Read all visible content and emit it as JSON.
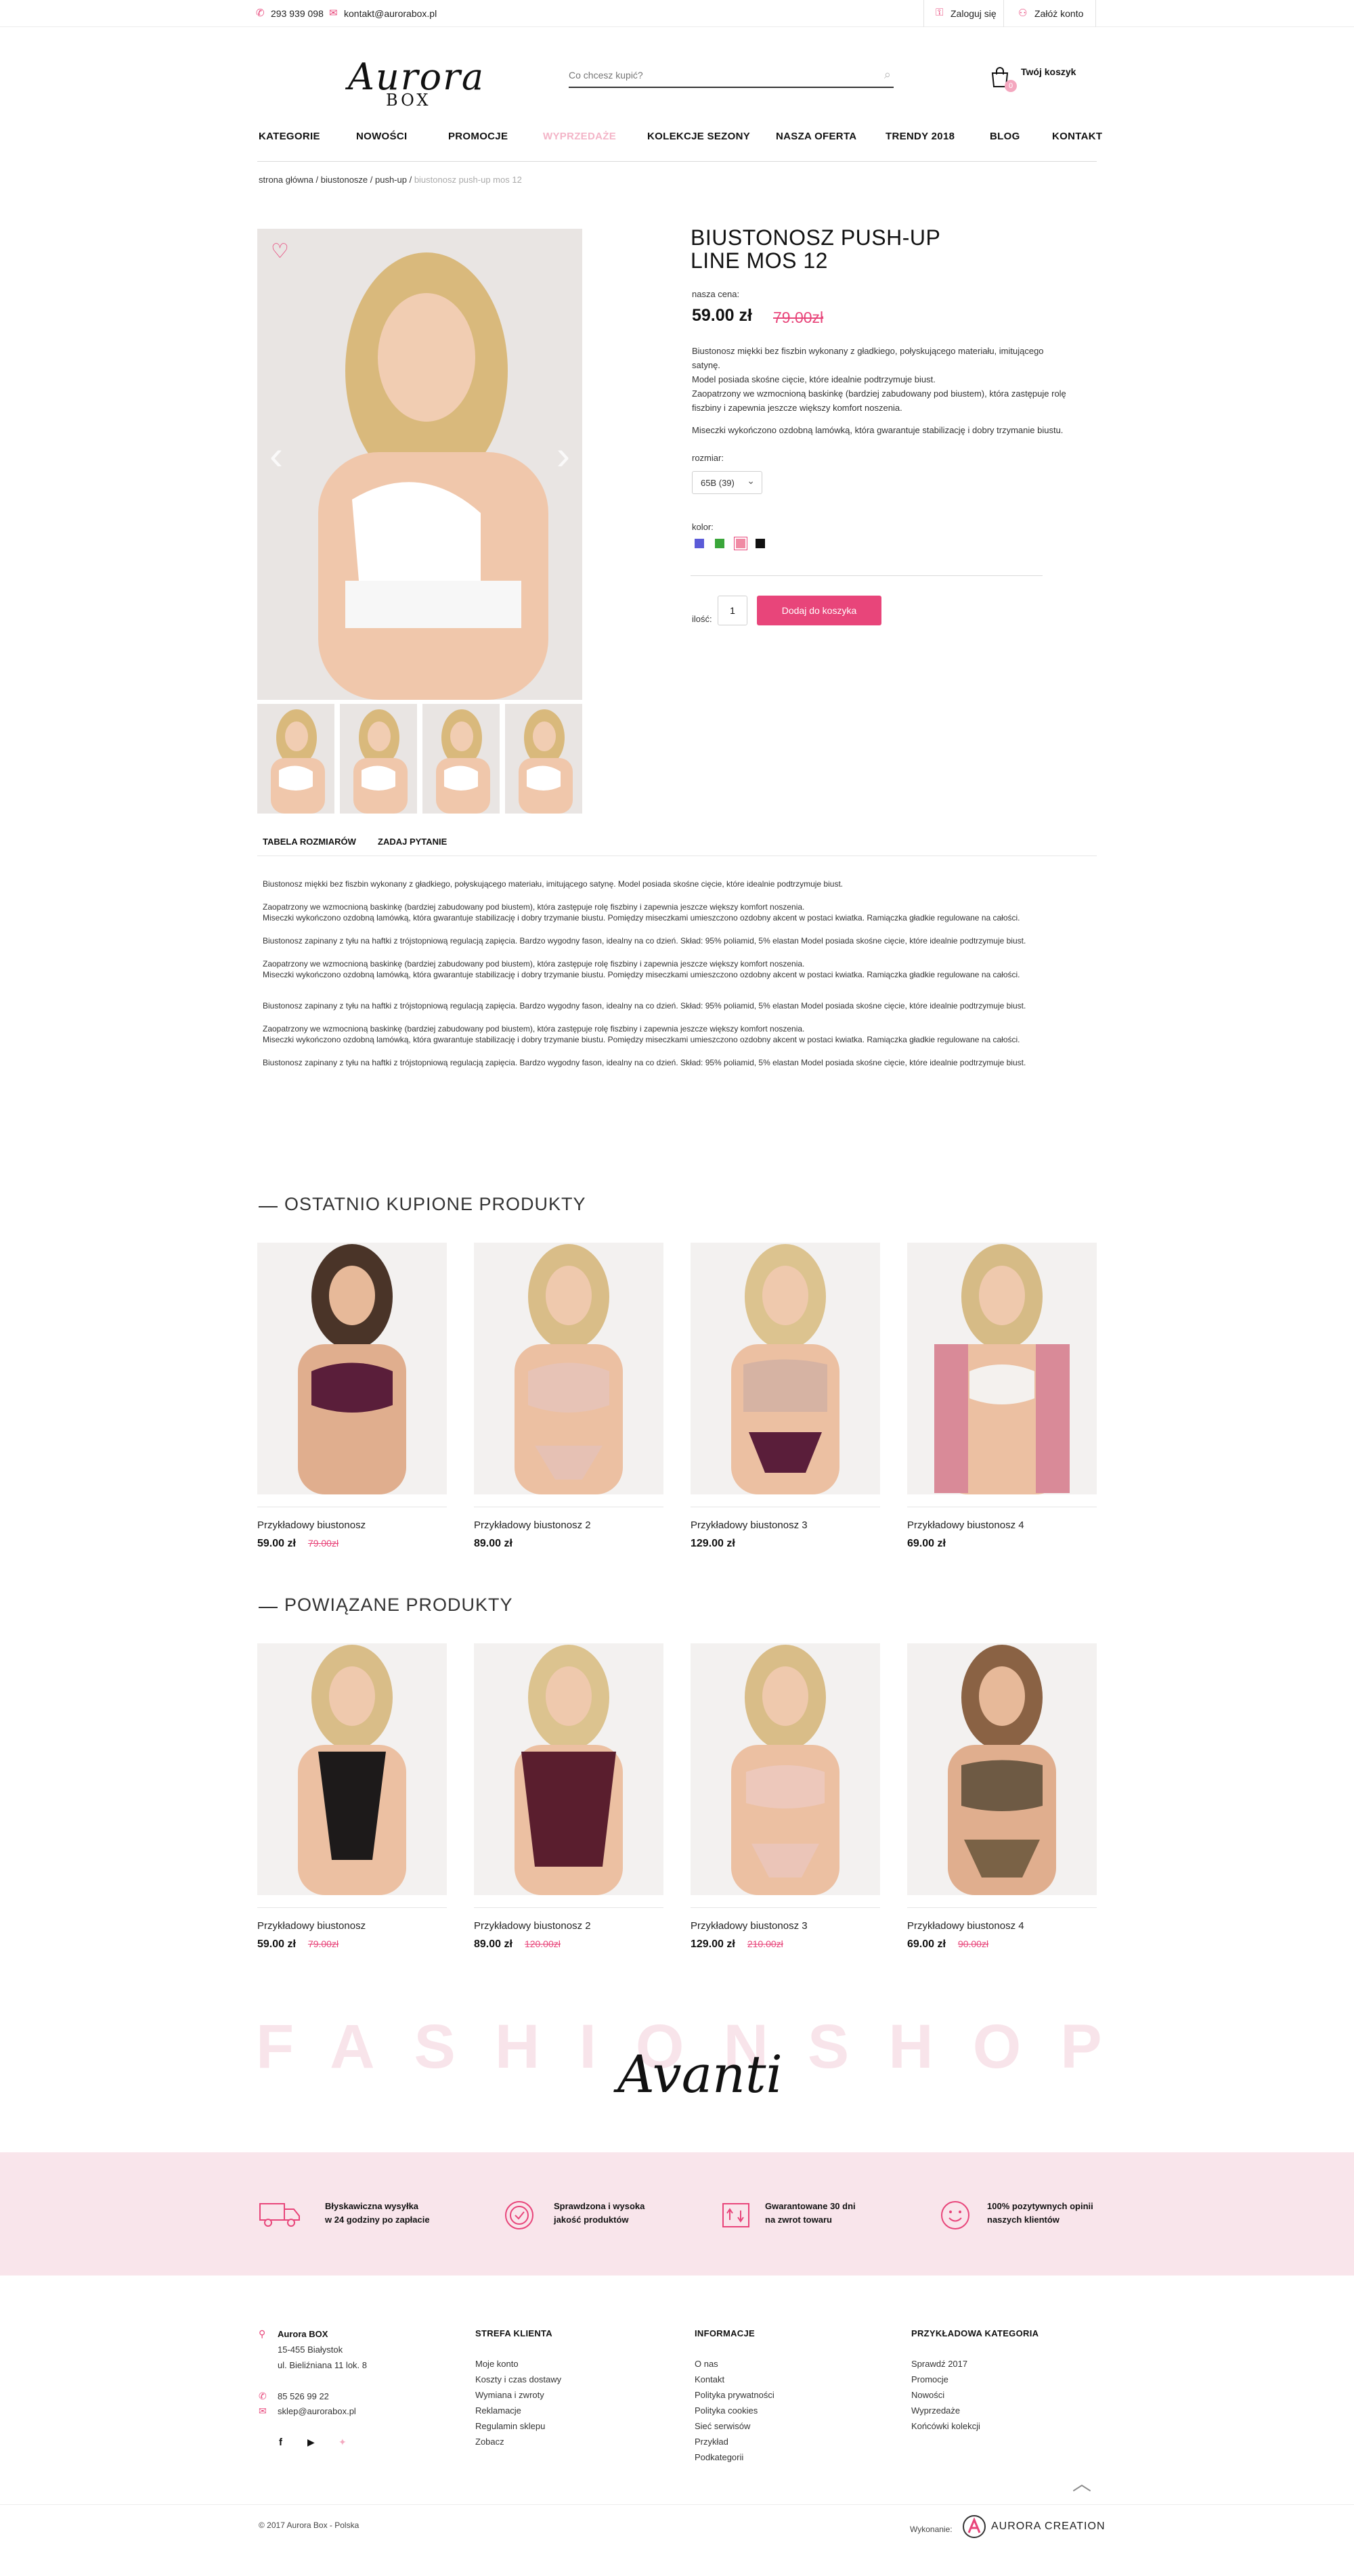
{
  "topbar": {
    "phone": "293 939 098",
    "email": "kontakt@aurorabox.pl",
    "login": "Zaloguj się",
    "register": "Załóż konto"
  },
  "logo": {
    "main": "Aurora",
    "sub": "BOX"
  },
  "search": {
    "placeholder": "Co chcesz kupić?"
  },
  "cart": {
    "label": "Twój koszyk",
    "count": "0"
  },
  "nav": [
    "KATEGORIE",
    "NOWOŚCI",
    "PROMOCJE",
    "WYPRZEDAŻE",
    "KOLEKCJE SEZONY",
    "NASZA OFERTA",
    "TRENDY 2018",
    "BLOG",
    "KONTAKT"
  ],
  "breadcrumb": {
    "path": "strona główna / biustonosze / push-up / ",
    "current": "biustonosz push-up mos 12"
  },
  "product": {
    "title_line1": "BIUSTONOSZ PUSH-UP",
    "title_line2": "LINE MOS 12",
    "price_label": "nasza cena:",
    "price": "59.00 zł",
    "old_price": "79.00zł",
    "desc1": "Biustonosz miękki bez fiszbin wykonany z gładkiego, połyskującego materiału, imitującego satynę.",
    "desc2": "Model posiada skośne cięcie, które idealnie podtrzymuje biust.",
    "desc3": "Zaopatrzony we wzmocnioną baskinkę (bardziej zabudowany pod biustem), która zastępuje rolę",
    "desc4": "fiszbiny i zapewnia jeszcze większy komfort noszenia.",
    "desc5": "Miseczki wykończono ozdobną lamówką, która gwarantuje stabilizację i dobry trzymanie biustu.",
    "size_label": "rozmiar:",
    "size_value": "65B (39)",
    "color_label": "kolor:",
    "colors": [
      "#5b5bd8",
      "#3aa63a",
      "#f08aa4",
      "#111111"
    ],
    "qty_label": "ilość:",
    "qty": "1",
    "add_to_cart": "Dodaj do koszyka"
  },
  "tabs": [
    "TABELA ROZMIARÓW",
    "ZADAJ PYTANIE"
  ],
  "description": [
    "Biustonosz miękki bez fiszbin wykonany z gładkiego, połyskującego materiału, imitującego satynę. Model posiada skośne cięcie, które idealnie podtrzymuje biust.",
    "Zaopatrzony we wzmocnioną baskinkę (bardziej zabudowany pod biustem), która zastępuje rolę fiszbiny i zapewnia jeszcze większy komfort noszenia.",
    "Miseczki wykończono ozdobną lamówką, która gwarantuje stabilizację i dobry trzymanie biustu. Pomiędzy miseczkami umieszczono ozdobny akcent w postaci kwiatka. Ramiączka gładkie regulowane na całości.",
    "Biustonosz zapinany z tyłu na haftki z trójstopniową regulacją zapięcia. Bardzo wygodny fason, idealny na co dzień. Skład: 95% poliamid, 5% elastan Model posiada skośne cięcie, które idealnie podtrzymuje biust.",
    "Zaopatrzony we wzmocnioną baskinkę (bardziej zabudowany pod biustem), która zastępuje rolę fiszbiny i zapewnia jeszcze większy komfort noszenia.",
    "Miseczki wykończono ozdobną lamówką, która gwarantuje stabilizację i dobry trzymanie biustu. Pomiędzy miseczkami umieszczono ozdobny akcent w postaci kwiatka. Ramiączka gładkie regulowane na całości.",
    "Biustonosz zapinany z tyłu na haftki z trójstopniową regulacją zapięcia. Bardzo wygodny fason, idealny na co dzień. Skład: 95% poliamid, 5% elastan Model posiada skośne cięcie, które idealnie podtrzymuje biust.",
    "Zaopatrzony we wzmocnioną baskinkę (bardziej zabudowany pod biustem), która zastępuje rolę fiszbiny i zapewnia jeszcze większy komfort noszenia.",
    "Miseczki wykończono ozdobną lamówką, która gwarantuje stabilizację i dobry trzymanie biustu. Pomiędzy miseczkami umieszczono ozdobny akcent w postaci kwiatka. Ramiączka gładkie regulowane na całości.",
    "Biustonosz zapinany z tyłu na haftki z trójstopniową regulacją zapięcia. Bardzo wygodny fason, idealny na co dzień. Skład: 95% poliamid, 5% elastan Model posiada skośne cięcie, które idealnie podtrzymuje biust."
  ],
  "recent": {
    "title": "OSTATNIO KUPIONE PRODUKTY",
    "items": [
      {
        "name": "Przykładowy biustonosz",
        "price": "59.00 zł",
        "old": "79.00zł"
      },
      {
        "name": "Przykładowy biustonosz 2",
        "price": "89.00 zł",
        "old": ""
      },
      {
        "name": "Przykładowy biustonosz 3",
        "price": "129.00 zł",
        "old": ""
      },
      {
        "name": "Przykładowy biustonosz 4",
        "price": "69.00 zł",
        "old": ""
      }
    ]
  },
  "related": {
    "title": "POWIĄZANE PRODUKTY",
    "items": [
      {
        "name": "Przykładowy biustonosz",
        "price": "59.00 zł",
        "old": "79.00zł"
      },
      {
        "name": "Przykładowy biustonosz 2",
        "price": "89.00 zł",
        "old": "120.00zł"
      },
      {
        "name": "Przykładowy biustonosz 3",
        "price": "129.00 zł",
        "old": "210.00zł"
      },
      {
        "name": "Przykładowy biustonosz 4",
        "price": "69.00 zł",
        "old": "90.00zł"
      }
    ]
  },
  "brand": {
    "watermark": "FASHIONSHOP",
    "script": "Avanti"
  },
  "features": [
    {
      "line1": "Błyskawiczna wysyłka",
      "line2": "w 24 godziny po zapłacie"
    },
    {
      "line1": "Sprawdzona i  wysoka",
      "line2": "jakość produktów"
    },
    {
      "line1": "Gwarantowane 30 dni",
      "line2": "na zwrot towaru"
    },
    {
      "line1": "100% pozytywnych opinii",
      "line2": "naszych klientów"
    }
  ],
  "footer": {
    "company": "Aurora BOX",
    "address1": "15-455 Białystok",
    "address2": "ul. Bieliźniana 11 lok. 8",
    "phone": "85 526 99 22",
    "email": "sklep@aurorabox.pl",
    "col1_title": "STREFA KLIENTA",
    "col1": [
      "Moje konto",
      "Koszty i czas dostawy",
      "Wymiana i zwroty",
      "Reklamacje",
      "Regulamin sklepu",
      "Zobacz"
    ],
    "col2_title": "INFORMACJE",
    "col2": [
      "O nas",
      "Kontakt",
      "Polityka prywatności",
      "Polityka cookies",
      "Sieć serwisów",
      "Przykład",
      "Podkategorii"
    ],
    "col3_title": "PRZYKŁADOWA KATEGORIA",
    "col3": [
      "Sprawdź 2017",
      "Promocje",
      "Nowości",
      "Wyprzedaże",
      "Końcówki kolekcji"
    ],
    "copyright": "© 2017 Aurora Box - Polska",
    "made_by": "Wykonanie:",
    "agency": "AURORA CREATION"
  },
  "colors": {
    "accent": "#e8457a",
    "pink_band": "#f8e4ea",
    "watermark": "#f7e3ea"
  }
}
